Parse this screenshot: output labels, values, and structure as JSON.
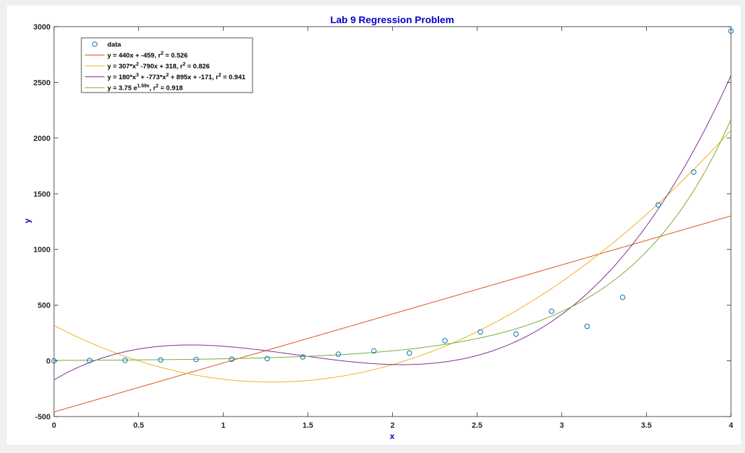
{
  "window": {
    "background": "#f0f0f0"
  },
  "chart_data": {
    "type": "scatter",
    "title": "Lab 9 Regression Problem",
    "xlabel": "x",
    "ylabel": "y",
    "xlim": [
      0,
      4
    ],
    "ylim": [
      -500,
      3000
    ],
    "xticks": [
      0,
      0.5,
      1,
      1.5,
      2,
      2.5,
      3,
      3.5,
      4
    ],
    "xtick_labels": [
      "0",
      "0.5",
      "1",
      "1.5",
      "2",
      "2.5",
      "3",
      "3.5",
      "4"
    ],
    "yticks": [
      -500,
      0,
      500,
      1000,
      1500,
      2000,
      2500,
      3000
    ],
    "ytick_labels": [
      "-500",
      "0",
      "500",
      "1000",
      "1500",
      "2000",
      "2500",
      "3000"
    ],
    "grid": false,
    "legend_position": "top-left",
    "data": {
      "name": "data",
      "color": "#0072bd",
      "x": [
        0,
        0.21,
        0.42,
        0.63,
        0.84,
        1.05,
        1.26,
        1.47,
        1.68,
        1.89,
        2.1,
        2.31,
        2.52,
        2.73,
        2.94,
        3.15,
        3.36,
        3.57,
        3.78,
        4.0
      ],
      "y": [
        0,
        3,
        5,
        8,
        12,
        15,
        20,
        35,
        60,
        90,
        70,
        180,
        260,
        240,
        445,
        310,
        570,
        1400,
        1695,
        2960
      ]
    },
    "fits": [
      {
        "kind": "linear",
        "label_parts": [
          "y = 440x + -459, r",
          "2",
          " = 0.526"
        ],
        "color": "#d95319",
        "coeffs": [
          440,
          -459
        ]
      },
      {
        "kind": "quadratic",
        "label_parts": [
          "y = 307*x",
          "2",
          " -790x + 318, r",
          "2",
          " = 0.826"
        ],
        "color": "#edb120",
        "coeffs": [
          307,
          -790,
          318
        ]
      },
      {
        "kind": "cubic",
        "label_parts": [
          "y = 180*x",
          "3",
          " + -773*x",
          "2",
          " + 895x + -171, r",
          "2",
          " = 0.941"
        ],
        "color": "#7e2f8e",
        "coeffs": [
          180,
          -773,
          895,
          -171
        ]
      },
      {
        "kind": "exponential",
        "label_parts": [
          "y = 3.75 e",
          "1.59x",
          ", r",
          "2",
          " = 0.918"
        ],
        "color": "#77ac30",
        "coeffs": [
          3.75,
          1.59
        ]
      }
    ]
  }
}
